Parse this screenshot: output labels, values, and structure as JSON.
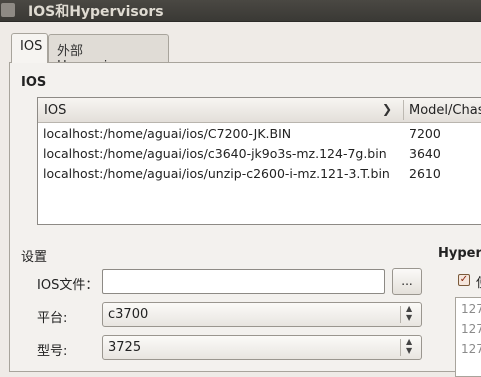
{
  "window": {
    "title": "IOS和Hypervisors"
  },
  "tabs": [
    {
      "label": "IOS"
    },
    {
      "label": "外部Hypervisors"
    }
  ],
  "ios_section": {
    "title": "IOS",
    "columns": {
      "image": "IOS",
      "model": "Model/Chas"
    },
    "rows": [
      {
        "image": "localhost:/home/aguai/ios/C7200-JK.BIN",
        "model": "7200"
      },
      {
        "image": "localhost:/home/aguai/ios/c3640-jk9o3s-mz.124-7g.bin",
        "model": "3640"
      },
      {
        "image": "localhost:/home/aguai/ios/unzip-c2600-i-mz.121-3.T.bin",
        "model": "2610"
      }
    ]
  },
  "settings": {
    "title": "设置",
    "ios_file_label": "IOS文件：",
    "ios_file_value": "",
    "browse_label": "...",
    "platform_label": "平台:",
    "platform_value": "c3700",
    "model_label": "型号:",
    "model_value": "3725"
  },
  "hypervisor_section": {
    "title": "Hyper",
    "checkbox_label": "使",
    "checkbox_checked": true,
    "list_items": [
      "127",
      "127",
      "127"
    ]
  },
  "icons": {
    "checkbox": "check-icon",
    "combo": "up-down-chevron-icon",
    "header_sort": "chevron-down-icon"
  }
}
